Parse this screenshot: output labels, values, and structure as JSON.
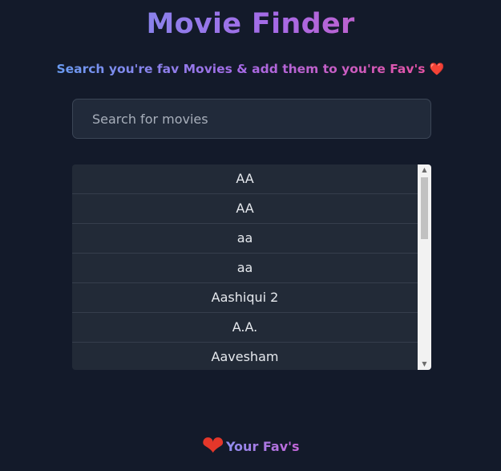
{
  "header": {
    "title": "Movie Finder",
    "subtitle": "Search you're fav Movies & add them to you're Fav's",
    "subtitle_emoji": "❤️"
  },
  "search": {
    "placeholder": "Search for movies",
    "value": ""
  },
  "results": {
    "items": [
      "AA",
      "AA",
      "aa",
      "aa",
      "Aashiqui 2",
      "A.A.",
      "Aavesham"
    ]
  },
  "favorites": {
    "icon": "heart-icon",
    "label": "Your Fav's"
  },
  "colors": {
    "background": "#131a2a",
    "gradient_start": "#6a9cf2",
    "gradient_mid": "#a66ae6",
    "gradient_end": "#e653a6",
    "heart": "#e4372a"
  }
}
